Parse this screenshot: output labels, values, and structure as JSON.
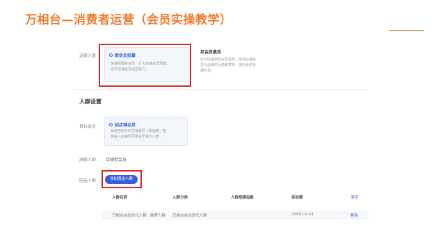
{
  "slide": {
    "title": "万相台—消费者运营（会员实操教学）"
  },
  "plan": {
    "label": "选择方案",
    "options": [
      {
        "title": "新会员招募",
        "desc_lines": [
          "快速招募新会员，扩大店铺会员规模，",
          "提升店铺会员运营能力。"
        ],
        "selected": true
      },
      {
        "title": "老会员激活",
        "desc_lines": [
          "针对店铺现有会员投放，激活店铺会",
          "员与品牌的互动和复购，提升会员长",
          "期价值。"
        ],
        "selected": false
      }
    ]
  },
  "crowd": {
    "section_title": "人群设置",
    "target_label": "目标会员",
    "target_option": {
      "title": "招店铺会员",
      "desc_lines": [
        "系统自动分析店铺会员人群画像，智",
        "能投入店铺和同类会员意向人群..."
      ]
    },
    "exclude_label": "屏蔽人群",
    "exclude_value": "店铺老会员",
    "add_label": "圈选人群",
    "add_button": "添加圈选人群"
  },
  "table": {
    "headers": [
      "人群名称",
      "人群分类",
      "人群规模指数",
      "有效期",
      "清空"
    ],
    "rows": [
      [
        "万相台自动迭代人群：推荐人群",
        "万相台自动迭代人群",
        "-",
        "2099-01-01",
        "移除"
      ]
    ]
  }
}
